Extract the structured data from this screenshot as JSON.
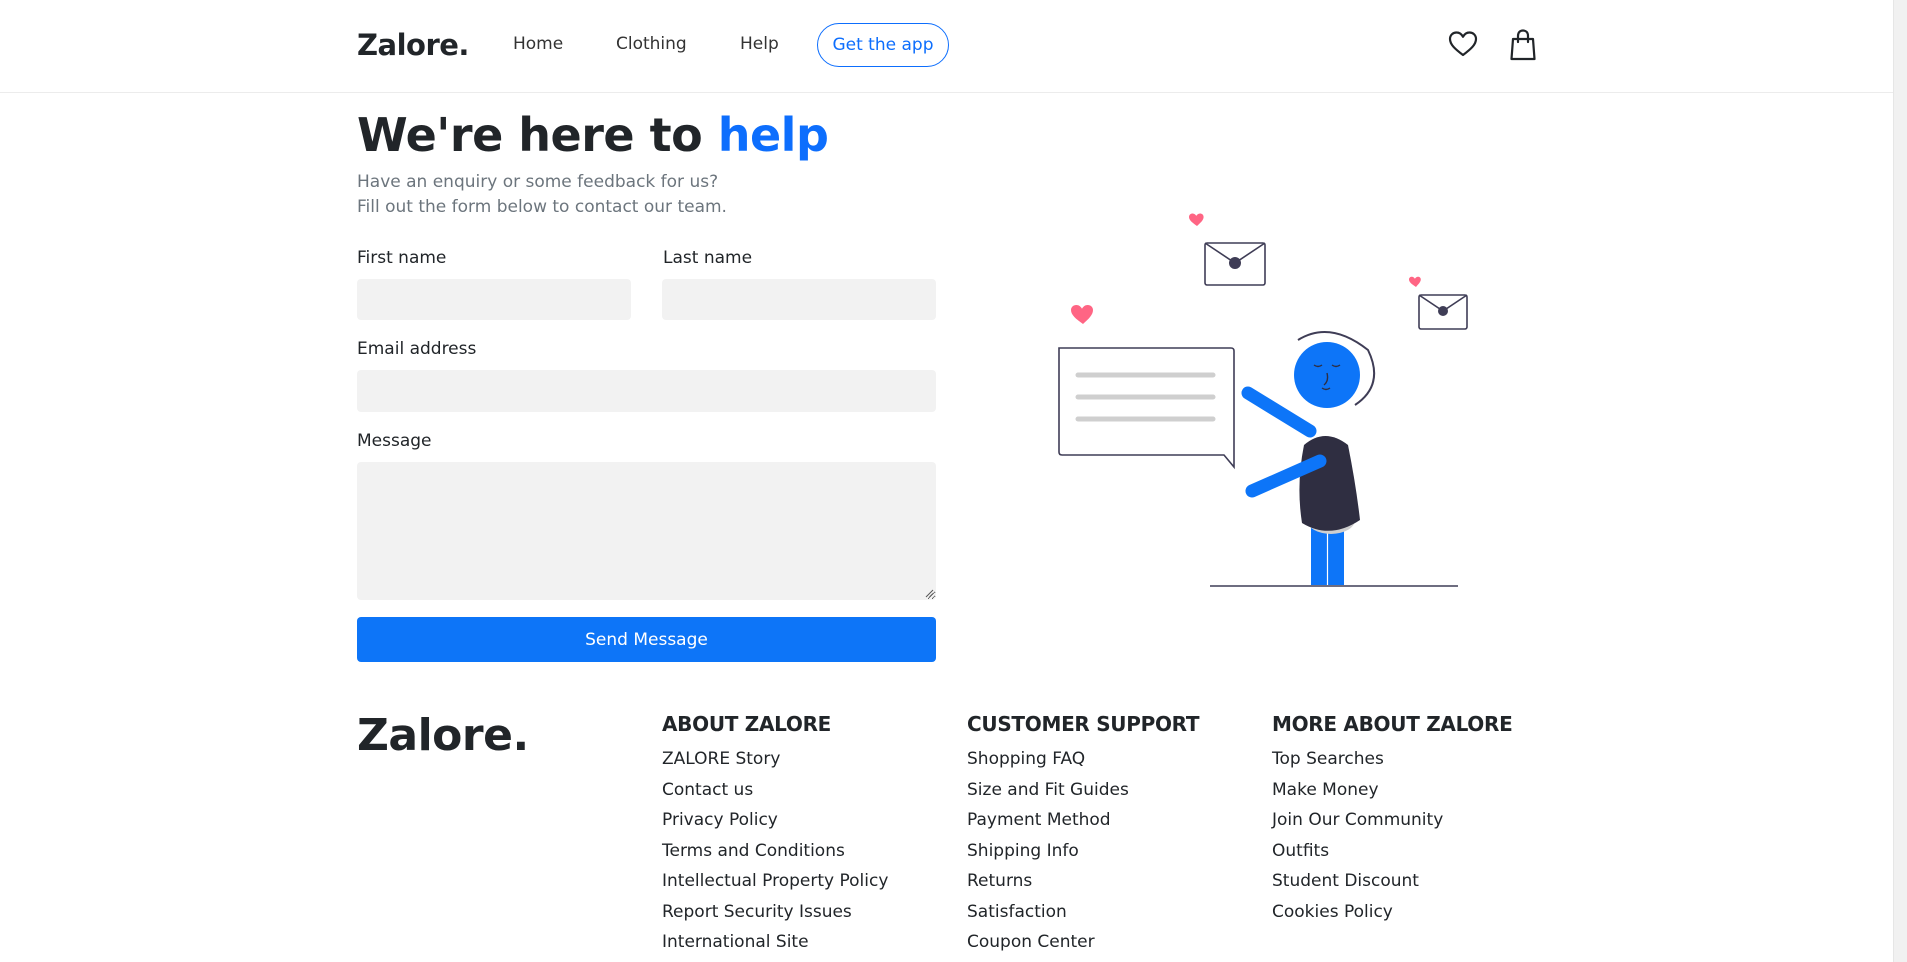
{
  "header": {
    "brand": "Zalore.",
    "nav": [
      "Home",
      "Clothing",
      "Help"
    ],
    "cta": "Get the app",
    "icons": [
      "heart-icon",
      "shopping-bag-icon"
    ]
  },
  "hero": {
    "title_prefix": "We're here to ",
    "title_accent": "help",
    "subtitle_line1": "Have an enquiry or some feedback for us?",
    "subtitle_line2": "Fill out the form below to contact our team."
  },
  "form": {
    "first_name_label": "First name",
    "last_name_label": "Last name",
    "email_label": "Email address",
    "message_label": "Message",
    "first_name_value": "",
    "last_name_value": "",
    "email_value": "",
    "message_value": "",
    "submit_label": "Send Message"
  },
  "footer": {
    "brand": "Zalore.",
    "columns": [
      {
        "title": "ABOUT ZALORE",
        "links": [
          "ZALORE Story",
          "Contact us",
          "Privacy Policy",
          "Terms and Conditions",
          "Intellectual Property Policy",
          "Report Security Issues",
          "International Site"
        ]
      },
      {
        "title": "CUSTOMER SUPPORT",
        "links": [
          "Shopping FAQ",
          "Size and Fit Guides",
          "Payment Method",
          "Shipping Info",
          "Returns",
          "Satisfaction",
          "Coupon Center"
        ]
      },
      {
        "title": "MORE ABOUT ZALORE",
        "links": [
          "Top Searches",
          "Make Money",
          "Join Our Community",
          "Outfits",
          "Student Discount",
          "Cookies Policy"
        ]
      }
    ]
  },
  "colors": {
    "accent": "#0d6efd",
    "button": "#0d75f8",
    "input_bg": "#f2f2f2",
    "heart": "#ff6584",
    "dark": "#2f2e41"
  }
}
